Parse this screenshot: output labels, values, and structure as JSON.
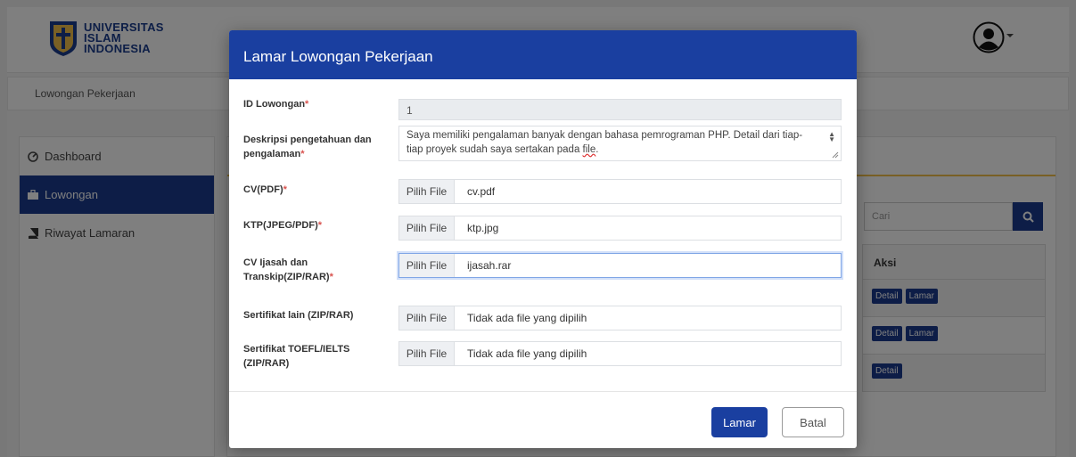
{
  "brand": {
    "line1": "UNIVERSITAS",
    "line2": "ISLAM",
    "line3": "INDONESIA",
    "color": "#1a3d8f"
  },
  "breadcrumb": "Lowongan Pekerjaan",
  "sidebar": {
    "items": [
      {
        "label": "Dashboard",
        "icon": "dashboard-icon",
        "active": false
      },
      {
        "label": "Lowongan",
        "icon": "briefcase-icon",
        "active": true
      },
      {
        "label": "Riwayat Lamaran",
        "icon": "book-icon",
        "active": false
      }
    ]
  },
  "background": {
    "search_placeholder": "Cari",
    "table_header": "Aksi",
    "rows": [
      {
        "buttons": [
          "Detail",
          "Lamar"
        ]
      },
      {
        "buttons": [
          "Detail",
          "Lamar"
        ]
      },
      {
        "buttons": [
          "Detail"
        ]
      }
    ]
  },
  "modal": {
    "title": "Lamar Lowongan Pekerjaan",
    "fields": {
      "id": {
        "label": "ID Lowongan",
        "required": "*",
        "value": "1"
      },
      "desc": {
        "label": "Deskripsi pengetahuan dan pengalaman",
        "required": "*",
        "value_main": "Saya memiliki pengalaman banyak dengan bahasa pemrograman PHP. Detail dari tiap-tiap proyek sudah saya sertakan pada ",
        "value_tail": "file",
        "value_end": "."
      },
      "cv": {
        "label": "CV(PDF)",
        "required": "*",
        "button": "Pilih File",
        "file": "cv.pdf"
      },
      "ktp": {
        "label": "KTP(JPEG/PDF)",
        "required": "*",
        "button": "Pilih File",
        "file": "ktp.jpg"
      },
      "ijasah": {
        "label": "CV Ijasah dan Transkip(ZIP/RAR)",
        "required": "*",
        "button": "Pilih File",
        "file": "ijasah.rar"
      },
      "sertifikat": {
        "label": "Sertifikat lain (ZIP/RAR)",
        "button": "Pilih File",
        "file": "Tidak ada file yang dipilih"
      },
      "toefl": {
        "label": "Sertifikat TOEFL/IELTS (ZIP/RAR)",
        "button": "Pilih File",
        "file": "Tidak ada file yang dipilih"
      }
    },
    "buttons": {
      "submit": "Lamar",
      "cancel": "Batal"
    },
    "accent": "#1a3fa0",
    "required_color": "#d9534f"
  }
}
